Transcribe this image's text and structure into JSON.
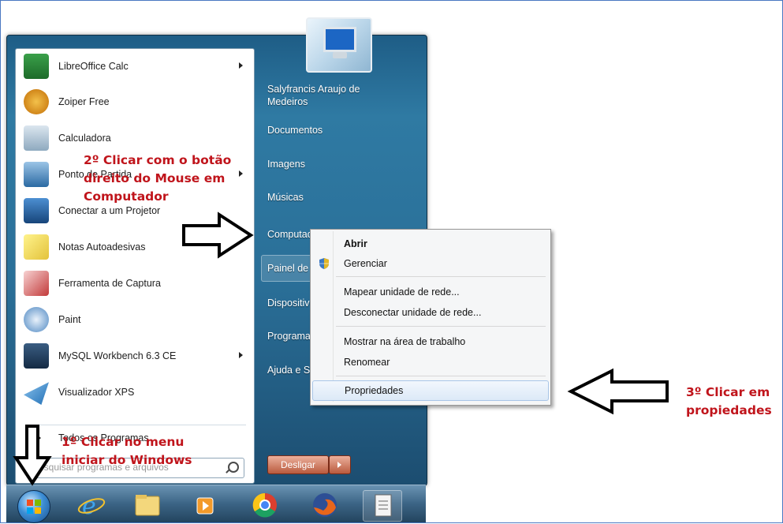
{
  "left_programs": [
    {
      "label": "LibreOffice Calc",
      "icon": "libreoffice-calc-icon",
      "submenu": true
    },
    {
      "label": "Zoiper Free",
      "icon": "zoiper-icon",
      "submenu": false
    },
    {
      "label": "Calculadora",
      "icon": "calculator-icon",
      "submenu": false
    },
    {
      "label": "Ponto de Partida",
      "icon": "getting-started-icon",
      "submenu": true
    },
    {
      "label": "Conectar a um Projetor",
      "icon": "projector-icon",
      "submenu": false
    },
    {
      "label": "Notas Autoadesivas",
      "icon": "sticky-notes-icon",
      "submenu": false
    },
    {
      "label": "Ferramenta de Captura",
      "icon": "snipping-tool-icon",
      "submenu": false
    },
    {
      "label": "Paint",
      "icon": "paint-icon",
      "submenu": false
    },
    {
      "label": "MySQL Workbench 6.3 CE",
      "icon": "mysql-workbench-icon",
      "submenu": true
    },
    {
      "label": "Visualizador XPS",
      "icon": "xps-viewer-icon",
      "submenu": false
    }
  ],
  "all_programs_label": "Todos os Programas",
  "search_placeholder": "Pesquisar programas e arquivos",
  "right_pane": {
    "user_name": "Salyfrancis Araujo de Medeiros",
    "items": [
      "Documentos",
      "Imagens",
      "Músicas",
      "Computador",
      "Painel de Controle",
      "Dispositivos e Impressoras",
      "Programas Padrão",
      "Ajuda e Suporte"
    ],
    "shutdown_label": "Desligar"
  },
  "context_menu": {
    "items": [
      "Abrir",
      "Gerenciar",
      "Mapear unidade de rede...",
      "Desconectar unidade de rede...",
      "Mostrar na área de trabalho",
      "Renomear",
      "Propriedades"
    ]
  },
  "annotations": {
    "step1": "1º Clicar no menu iniciar do Windows",
    "step2": "2º Clicar com o botão direito do Mouse em Computador",
    "step3": "3º Clicar em propiedades"
  },
  "colors": {
    "annotation": "#c0141b",
    "taskbar": "#3b6485",
    "menu_glass": "#2a6f98"
  }
}
